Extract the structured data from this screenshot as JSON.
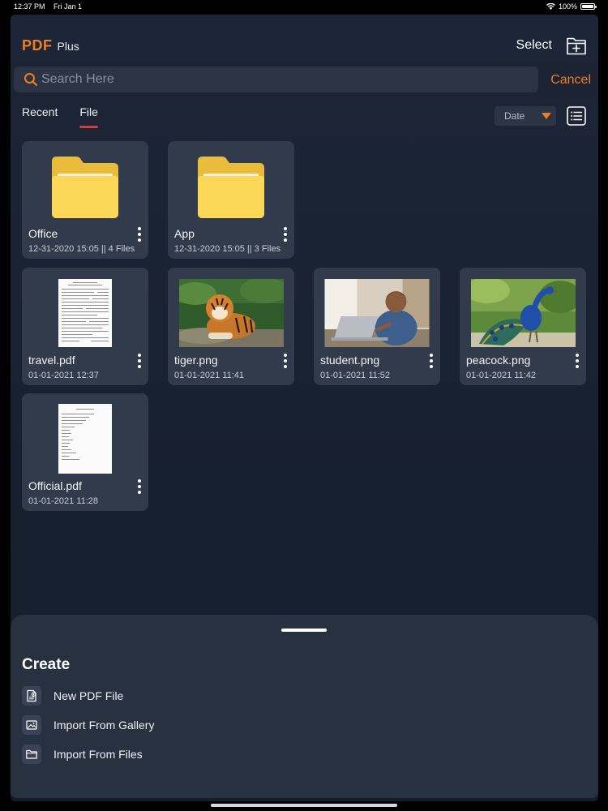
{
  "status_bar": {
    "time": "12:37 PM",
    "date": "Fri Jan 1",
    "battery": "100%"
  },
  "header": {
    "brand_main": "PDF",
    "brand_sub": "Plus",
    "select_label": "Select"
  },
  "search": {
    "placeholder": "Search Here",
    "value": "",
    "cancel_label": "Cancel"
  },
  "tabs": [
    {
      "label": "Recent",
      "active": false
    },
    {
      "label": "File",
      "active": true
    }
  ],
  "sort": {
    "selected": "Date"
  },
  "colors": {
    "accent": "#f07d1f",
    "tab_underline": "#d63b3b",
    "folder": "#fbd64f"
  },
  "folders": [
    {
      "name": "Office",
      "meta": "12-31-2020 15:05 || 4 Files",
      "icon": "folder-icon"
    },
    {
      "name": "App",
      "meta": "12-31-2020 15:05 || 3 Files",
      "icon": "folder-icon"
    }
  ],
  "files": [
    {
      "name": "travel.pdf",
      "meta": "01-01-2021 12:37",
      "thumb": "pdf-form"
    },
    {
      "name": "tiger.png",
      "meta": "01-01-2021 11:41",
      "thumb": "tiger-photo"
    },
    {
      "name": "student.png",
      "meta": "01-01-2021 11:52",
      "thumb": "student-photo"
    },
    {
      "name": "peacock.png",
      "meta": "01-01-2021 11:42",
      "thumb": "peacock-photo"
    },
    {
      "name": "Official.pdf",
      "meta": "01-01-2021 11:28",
      "thumb": "pdf-document"
    }
  ],
  "sheet": {
    "title": "Create",
    "items": [
      {
        "label": "New PDF File",
        "icon": "new-pdf-icon"
      },
      {
        "label": "Import From Gallery",
        "icon": "gallery-icon"
      },
      {
        "label": "Import From Files",
        "icon": "folder-outline-icon"
      }
    ]
  }
}
